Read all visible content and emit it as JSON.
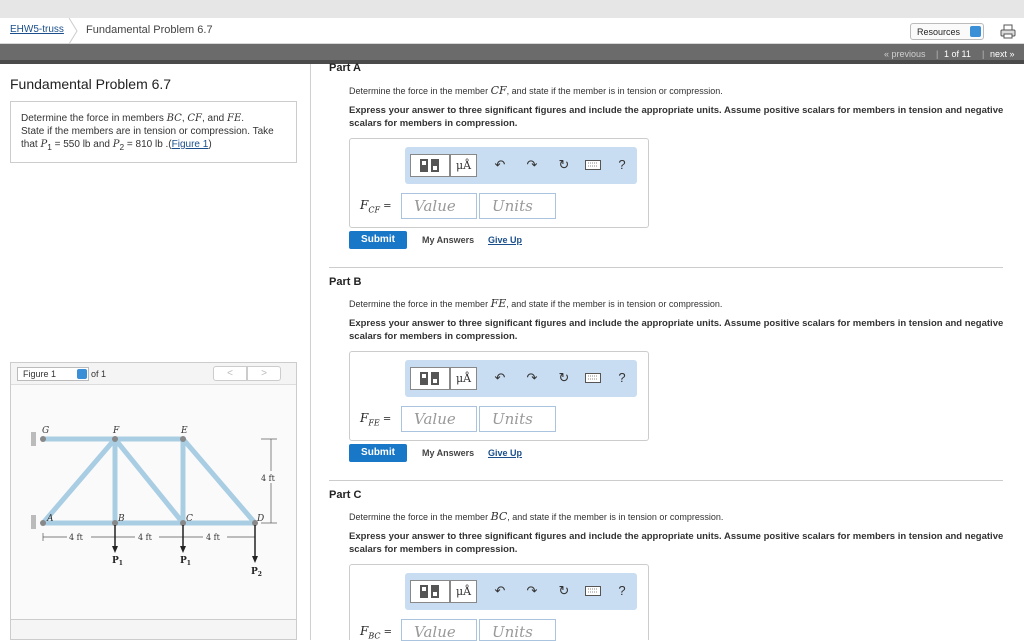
{
  "header": {
    "breadcrumb_course": "EHW5-truss",
    "breadcrumb_item": "Fundamental Problem 6.7",
    "resources_label": "Resources"
  },
  "nav": {
    "previous": "« previous",
    "position": "1 of 11",
    "next": "next »"
  },
  "left": {
    "title": "Fundamental Problem 6.7",
    "problem": {
      "t1": "Determine the force in members ",
      "m1": "BC",
      "t2": ", ",
      "m2": "CF",
      "t3": ", and ",
      "m3": "FE",
      "t4": ".",
      "line2": "State if the members are in tension or compression. Take",
      "t5": "that ",
      "p1": "P",
      "p1sub": "1",
      "t6": " = 550 lb and ",
      "p2": "P",
      "p2sub": "2",
      "t7": " = 810 lb .(",
      "fig_link": "Figure 1",
      "t8": ")"
    },
    "figure": {
      "select_label": "Figure 1",
      "of_label": "of 1",
      "prev": "<",
      "next": ">",
      "labels": {
        "G": "G",
        "F": "F",
        "E": "E",
        "A": "A",
        "B": "B",
        "C": "C",
        "D": "D",
        "dim1": "4 ft",
        "dim2": "4 ft",
        "dim3": "4 ft",
        "dim_v": "4 ft",
        "p1a": "P",
        "p1a_sub": "1",
        "p1b": "P",
        "p1b_sub": "1",
        "p2": "P",
        "p2_sub": "2"
      }
    }
  },
  "parts": [
    {
      "title": "Part A",
      "q_pre": "Determine the force in the member ",
      "q_member": "CF",
      "q_post": ", and state if the member is in tension or compression.",
      "instruction": "Express your answer to three significant figures and include the appropriate units. Assume positive scalars for members in tension and negative scalars for members in compression.",
      "var": "F",
      "var_sub": "CF",
      "eq": " =",
      "value_placeholder": "Value",
      "units_placeholder": "Units",
      "submit": "Submit",
      "my_answers": "My Answers",
      "give_up": "Give Up"
    },
    {
      "title": "Part B",
      "q_pre": "Determine the force in the member ",
      "q_member": "FE",
      "q_post": ", and state if the member is in tension or compression.",
      "instruction": "Express your answer to three significant figures and include the appropriate units. Assume positive scalars for members in tension and negative scalars for members in compression.",
      "var": "F",
      "var_sub": "FE",
      "eq": " =",
      "value_placeholder": "Value",
      "units_placeholder": "Units",
      "submit": "Submit",
      "my_answers": "My Answers",
      "give_up": "Give Up"
    },
    {
      "title": "Part C",
      "q_pre": "Determine the force in the member ",
      "q_member": "BC",
      "q_post": ", and state if the member is in tension or compression.",
      "instruction": "Express your answer to three significant figures and include the appropriate units. Assume positive scalars for members in tension and negative scalars for members in compression.",
      "var": "F",
      "var_sub": "BC",
      "eq": " =",
      "value_placeholder": "Value",
      "units_placeholder": "Units"
    }
  ],
  "toolbar": {
    "mu_label": "μÅ",
    "help": "?",
    "icons": [
      "templates-icon",
      "units-icon",
      "undo-icon",
      "redo-icon",
      "reset-icon",
      "keyboard-icon",
      "help-icon"
    ]
  },
  "colors": {
    "accent": "#1977c8",
    "toolbar_bg": "#c9ddf2",
    "navbar": "#6b6b6b",
    "truss_member": "#a9cde3"
  }
}
